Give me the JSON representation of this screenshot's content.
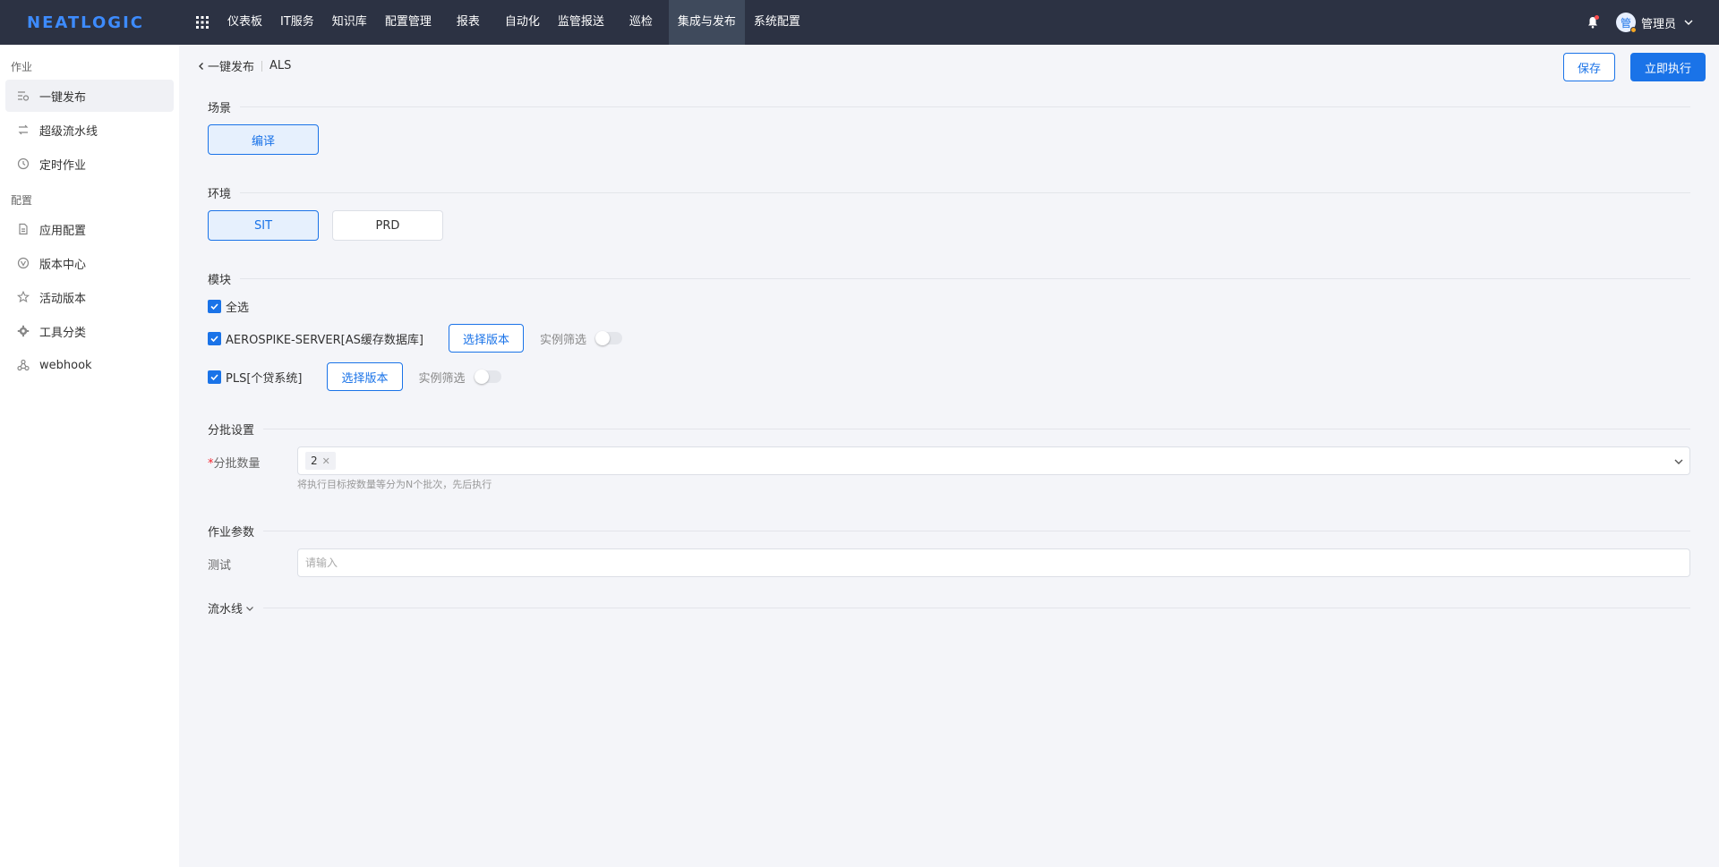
{
  "header": {
    "logo": "NEATLOGIC",
    "nav": [
      "仪表板",
      "IT服务",
      "知识库",
      "配置管理",
      "报表",
      "自动化",
      "监管报送",
      "巡检",
      "集成与发布",
      "系统配置"
    ],
    "active_nav": "集成与发布",
    "avatar_char": "管",
    "username": "管理员"
  },
  "sidebar": {
    "group_job": "作业",
    "group_config": "配置",
    "items": [
      "一键发布",
      "超级流水线",
      "定时作业",
      "应用配置",
      "版本中心",
      "活动版本",
      "工具分类",
      "webhook"
    ]
  },
  "breadcrumb": {
    "back": "一键发布",
    "current": "ALS"
  },
  "actions": {
    "save": "保存",
    "run": "立即执行"
  },
  "scene": {
    "title": "场景",
    "option": "编译"
  },
  "env": {
    "title": "环境",
    "options": [
      "SIT",
      "PRD"
    ]
  },
  "modules": {
    "title": "模块",
    "select_all": "全选",
    "items": [
      "AEROSPIKE-SERVER[AS缓存数据库]",
      "PLS[个贷系统]"
    ],
    "version_button": "选择版本",
    "filter_label": "实例筛选"
  },
  "batch": {
    "title": "分批设置",
    "label": "分批数量",
    "required_mark": "*",
    "value": "2",
    "hint": "将执行目标按数量等分为N个批次，先后执行"
  },
  "params": {
    "title": "作业参数",
    "label": "测试",
    "placeholder": "请输入"
  },
  "pipeline": {
    "title": "流水线"
  },
  "colors": {
    "primary": "#1a73e8",
    "topbar": "#2c3243",
    "background": "#f4f5f9"
  }
}
